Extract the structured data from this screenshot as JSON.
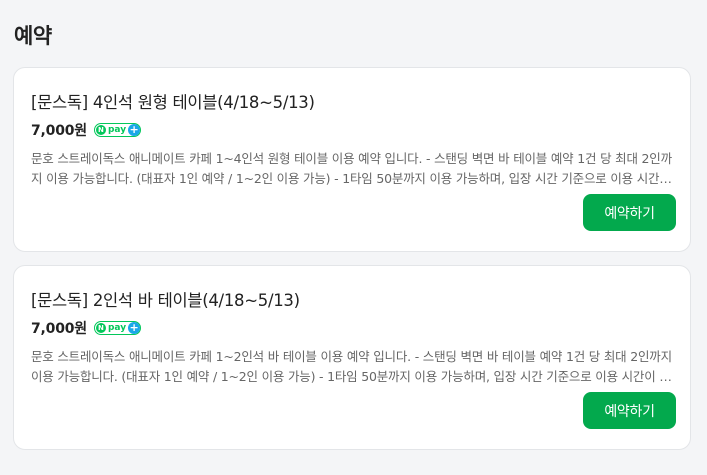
{
  "section": {
    "title": "예약"
  },
  "items": [
    {
      "title": "[문스독] 4인석 원형 테이블(4/18~5/13)",
      "price": "7,000원",
      "npay": {
        "n": "N",
        "pay": "pay",
        "plus": "+"
      },
      "description": "문호 스트레이독스 애니메이트 카페 1~4인석 원형 테이블 이용 예약 입니다. - 스탠딩 벽면 바 테이블 예약 1건 당 최대 2인까지 이용 가능합니다. (대표자 1인 예약 / 1~2인 이용 가능) - 1타임 50분까지 이용 가능하며, 입장 시간 기준으로 이용 시간이 산정됩니다.",
      "button": "예약하기"
    },
    {
      "title": "[문스독] 2인석 바 테이블(4/18~5/13)",
      "price": "7,000원",
      "npay": {
        "n": "N",
        "pay": "pay",
        "plus": "+"
      },
      "description": "문호 스트레이독스 애니메이트 카페 1~2인석 바 테이블 이용 예약 입니다. - 스탠딩 벽면 바 테이블 예약 1건 당 최대 2인까지 이용 가능합니다. (대표자 1인 예약 / 1~2인 이용 가능) - 1타임 50분까지 이용 가능하며, 입장 시간 기준으로 이용 시간이 산정됩니다.",
      "button": "예약하기"
    }
  ],
  "colors": {
    "accent": "#03a94d",
    "npay_green": "#03c75a",
    "npay_blue": "#1aa7e8"
  }
}
